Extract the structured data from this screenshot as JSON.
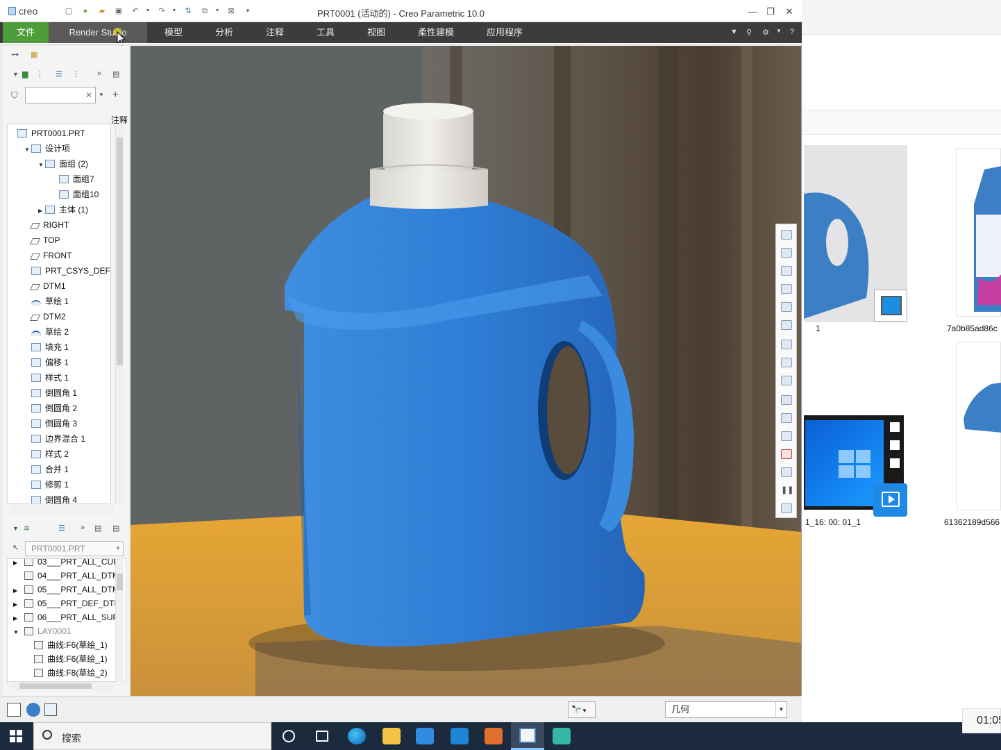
{
  "window": {
    "title": "PRT0001 (活动的) - Creo Parametric 10.0",
    "logo": "creo"
  },
  "menubar": {
    "items": [
      "文件",
      "Render Studio",
      "模型",
      "分析",
      "注释",
      "工具",
      "视图",
      "柔性建模",
      "应用程序"
    ]
  },
  "model_tree": {
    "column_header": "注释",
    "items": [
      {
        "label": "PRT0001.PRT",
        "indent": 0,
        "icon": "part-icon"
      },
      {
        "label": "设计项",
        "indent": 1,
        "icon": "design-items-icon",
        "expand": "open"
      },
      {
        "label": "面组 (2)",
        "indent": 2,
        "icon": "quilt-group-icon",
        "expand": "open"
      },
      {
        "label": "面组7",
        "indent": 3,
        "icon": "quilt-icon"
      },
      {
        "label": "面组10",
        "indent": 3,
        "icon": "quilt-icon"
      },
      {
        "label": "主体 (1)",
        "indent": 2,
        "icon": "body-icon",
        "expand": "closed"
      },
      {
        "label": "RIGHT",
        "indent": 1,
        "icon": "datum-plane-icon"
      },
      {
        "label": "TOP",
        "indent": 1,
        "icon": "datum-plane-icon"
      },
      {
        "label": "FRONT",
        "indent": 1,
        "icon": "datum-plane-icon"
      },
      {
        "label": "PRT_CSYS_DEF",
        "indent": 1,
        "icon": "csys-icon"
      },
      {
        "label": "DTM1",
        "indent": 1,
        "icon": "datum-plane-icon"
      },
      {
        "label": "草绘 1",
        "indent": 1,
        "icon": "sketch-icon"
      },
      {
        "label": "DTM2",
        "indent": 1,
        "icon": "datum-plane-icon"
      },
      {
        "label": "草绘 2",
        "indent": 1,
        "icon": "sketch-icon"
      },
      {
        "label": "填充 1",
        "indent": 1,
        "icon": "fill-icon"
      },
      {
        "label": "偏移 1",
        "indent": 1,
        "icon": "offset-icon"
      },
      {
        "label": "样式 1",
        "indent": 1,
        "icon": "style-icon"
      },
      {
        "label": "倒圆角 1",
        "indent": 1,
        "icon": "round-icon"
      },
      {
        "label": "倒圆角 2",
        "indent": 1,
        "icon": "round-icon"
      },
      {
        "label": "倒圆角 3",
        "indent": 1,
        "icon": "round-icon"
      },
      {
        "label": "边界混合 1",
        "indent": 1,
        "icon": "boundary-blend-icon"
      },
      {
        "label": "样式 2",
        "indent": 1,
        "icon": "style-icon"
      },
      {
        "label": "合并 1",
        "indent": 1,
        "icon": "merge-icon"
      },
      {
        "label": "修剪 1",
        "indent": 1,
        "icon": "trim-icon"
      },
      {
        "label": "倒圆角 4",
        "indent": 1,
        "icon": "round-icon"
      }
    ]
  },
  "layer_tree": {
    "selector": "PRT0001.PRT",
    "items": [
      {
        "label": "03___PRT_ALL_CUR",
        "expand": "closed"
      },
      {
        "label": "04___PRT_ALL_DTM",
        "expand": "none"
      },
      {
        "label": "05___PRT_ALL_DTM",
        "expand": "closed"
      },
      {
        "label": "05___PRT_DEF_DTM",
        "expand": "closed"
      },
      {
        "label": "06___PRT_ALL_SUR",
        "expand": "closed"
      },
      {
        "label": "LAY0001",
        "expand": "open",
        "dim": true
      },
      {
        "label": "曲线:F6(草绘_1)",
        "child": true
      },
      {
        "label": "曲线:F6(草绘_1)",
        "child": true
      },
      {
        "label": "曲线:F8(草绘_2)",
        "child": true
      }
    ]
  },
  "status": {
    "filter_value": "几何"
  },
  "explorer": {
    "labels": [
      "1",
      "7a0b85ad86c",
      "1_16: 00: 01_1",
      "61362189d566"
    ]
  },
  "taskbar": {
    "search": "搜索",
    "clock": "01:05"
  },
  "colors": {
    "menu_bg": "#3c3c3c",
    "file_tab": "#4f9d3a",
    "bottle": "#3a86d8",
    "cap": "#e6e4e0",
    "taskbar": "#1b2a3d"
  }
}
